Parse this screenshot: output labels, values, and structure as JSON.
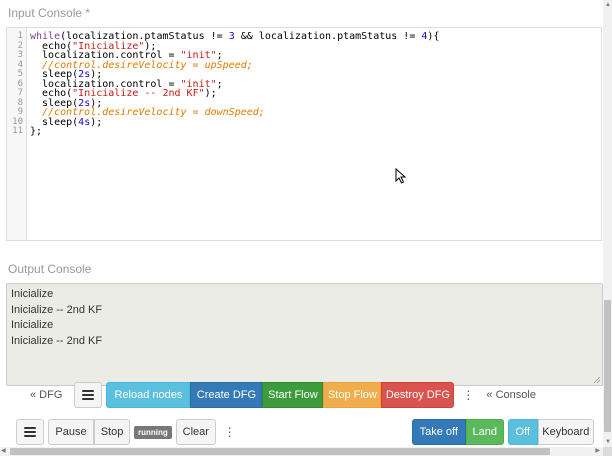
{
  "input_console": {
    "label": "Input Console *",
    "line_numbers": [
      "1",
      "2",
      "3",
      "4",
      "5",
      "6",
      "7",
      "8",
      "9",
      "10",
      "11"
    ],
    "lines": [
      [
        {
          "t": "kw",
          "v": "while"
        },
        {
          "t": "",
          "v": "(localization.ptamStatus != "
        },
        {
          "t": "num",
          "v": "3"
        },
        {
          "t": "",
          "v": " && localization.ptamStatus != "
        },
        {
          "t": "num",
          "v": "4"
        },
        {
          "t": "",
          "v": "){"
        }
      ],
      [
        {
          "t": "",
          "v": "  echo("
        },
        {
          "t": "str",
          "v": "\"Inicialize\""
        },
        {
          "t": "",
          "v": ");"
        }
      ],
      [
        {
          "t": "",
          "v": "  localization.control = "
        },
        {
          "t": "str",
          "v": "\"init\""
        },
        {
          "t": "",
          "v": ";"
        }
      ],
      [
        {
          "t": "cm",
          "v": "  //control.desireVelocity = upSpeed;"
        }
      ],
      [
        {
          "t": "",
          "v": "  sleep("
        },
        {
          "t": "num",
          "v": "2s"
        },
        {
          "t": "",
          "v": ");"
        }
      ],
      [
        {
          "t": "",
          "v": "  localization.control = "
        },
        {
          "t": "str",
          "v": "\"init\""
        },
        {
          "t": "",
          "v": ";"
        }
      ],
      [
        {
          "t": "",
          "v": "  echo("
        },
        {
          "t": "str",
          "v": "\"Inicialize -- 2nd KF\""
        },
        {
          "t": "",
          "v": ");"
        }
      ],
      [
        {
          "t": "",
          "v": "  sleep("
        },
        {
          "t": "num",
          "v": "2s"
        },
        {
          "t": "",
          "v": ");"
        }
      ],
      [
        {
          "t": "cm",
          "v": "  //control.desireVelocity = downSpeed;"
        }
      ],
      [
        {
          "t": "",
          "v": "  sleep("
        },
        {
          "t": "num",
          "v": "4s"
        },
        {
          "t": "",
          "v": ");"
        }
      ],
      [
        {
          "t": "",
          "v": "};"
        }
      ]
    ]
  },
  "output_console": {
    "label": "Output Console",
    "lines": [
      "Inicialize",
      "Inicialize -- 2nd KF",
      "Inicialize",
      "Inicialize -- 2nd KF"
    ]
  },
  "toolbar_top": {
    "dfg_toggle": "« DFG",
    "reload_nodes": "Reload nodes",
    "create_dfg": "Create DFG",
    "start_flow": "Start Flow",
    "stop_flow": "Stop Flow",
    "destroy_dfg": "Destroy DFG",
    "more": "⋮",
    "console_toggle": "« Console"
  },
  "toolbar_bottom": {
    "pause": "Pause",
    "stop": "Stop",
    "status_badge": "running",
    "clear": "Clear",
    "more": "⋮",
    "take_off": "Take off",
    "land": "Land",
    "off": "Off",
    "keyboard": "Keyboard"
  },
  "icons": {
    "menu": "hamburger-icon",
    "cursor": "mouse-pointer-icon",
    "grip": "resize-grip-icon"
  },
  "colors": {
    "info": "#5bc0de",
    "primary": "#337ab7",
    "success": "#5cb85c",
    "warning": "#f0ad4e",
    "danger": "#d9534f"
  }
}
